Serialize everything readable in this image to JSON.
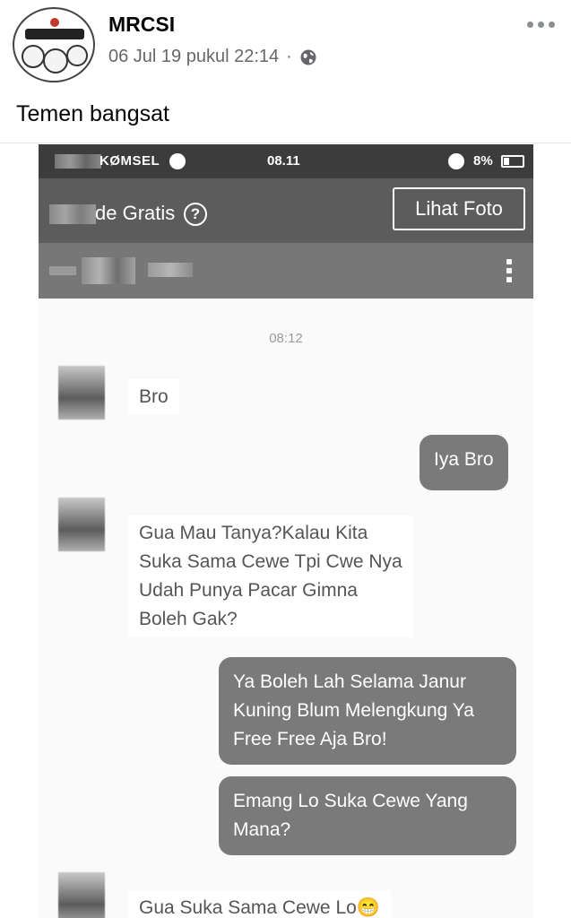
{
  "post": {
    "author": "MRCSI",
    "date": "06 Jul 19 pukul 22:14",
    "separator": "·",
    "text": "Temen bangsat"
  },
  "screenshot": {
    "status_bar": {
      "carrier": "KØMSEL",
      "time": "08.11",
      "battery": "8%"
    },
    "app_bar": {
      "title": "de Gratis",
      "help": "?",
      "photo_button": "Lihat Foto"
    },
    "chat": {
      "timestamp": "08:12",
      "messages": [
        {
          "from": "them",
          "text": "Bro"
        },
        {
          "from": "me",
          "text": "Iya Bro"
        },
        {
          "from": "them",
          "text": "Gua Mau Tanya?Kalau Kita Suka Sama Cewe Tpi Cwe Nya Udah Punya Pacar Gimna Boleh Gak?"
        },
        {
          "from": "me",
          "text": "Ya Boleh Lah Selama Janur Kuning Blum Melengkung Ya Free Free Aja Bro!"
        },
        {
          "from": "me",
          "text": "Emang Lo Suka Cewe Yang Mana?"
        },
        {
          "from": "them",
          "text": "Gua Suka Sama Cewe Lo😁"
        }
      ]
    }
  },
  "colors": {
    "accent": "#1877f2",
    "status_bar": "#3c3c3c",
    "app_bar": "#5c5c5c",
    "contact_bar": "#777777",
    "outgoing_bubble": "#7a7a7a"
  }
}
